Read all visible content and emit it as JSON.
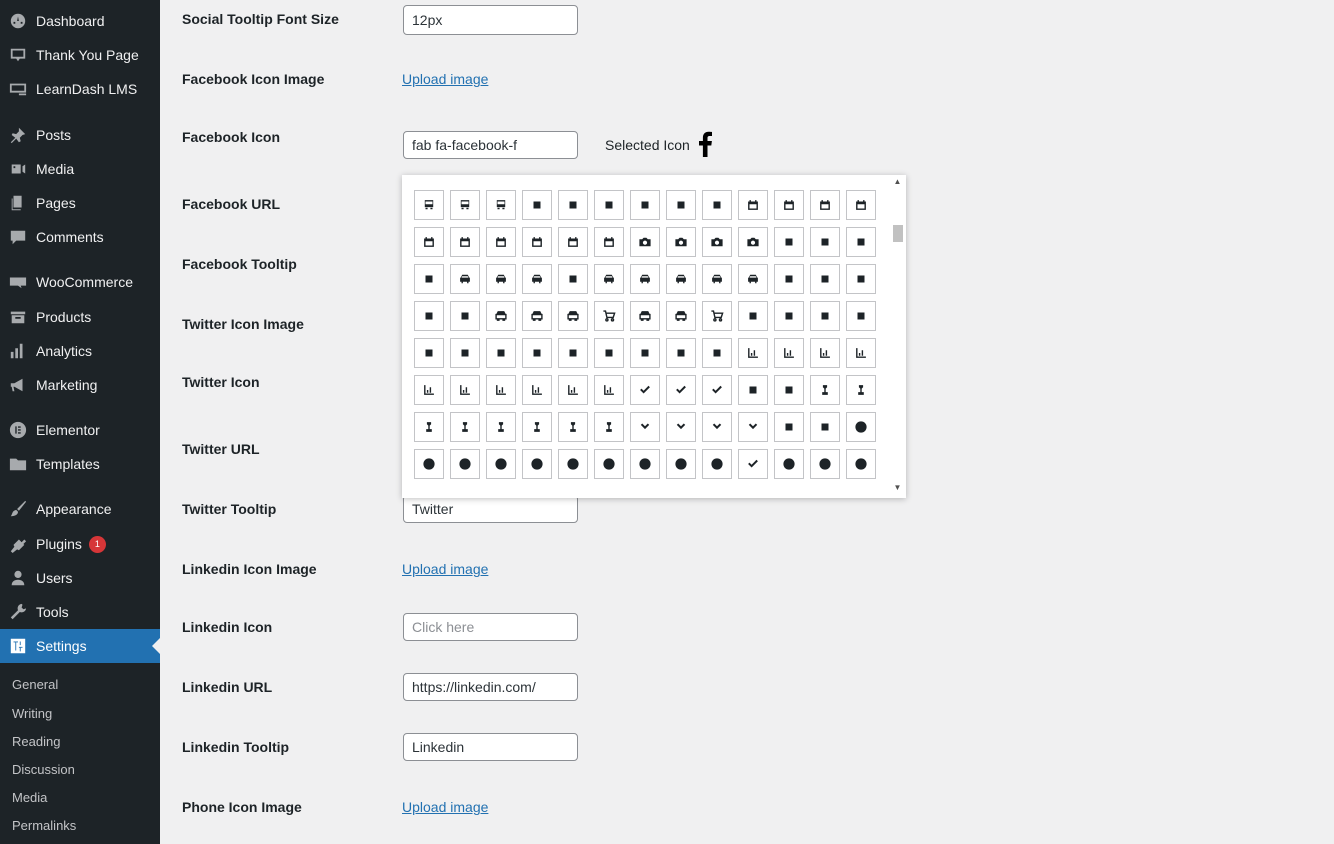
{
  "sidebar": {
    "items": [
      {
        "label": "Dashboard",
        "icon": "dashboard-icon"
      },
      {
        "label": "Thank You Page",
        "icon": "thank-you-icon"
      },
      {
        "label": "LearnDash LMS",
        "icon": "learndash-icon"
      },
      {
        "label": "Posts",
        "icon": "pin-icon"
      },
      {
        "label": "Media",
        "icon": "media-icon"
      },
      {
        "label": "Pages",
        "icon": "pages-icon"
      },
      {
        "label": "Comments",
        "icon": "comments-icon"
      },
      {
        "label": "WooCommerce",
        "icon": "woocommerce-icon"
      },
      {
        "label": "Products",
        "icon": "products-icon"
      },
      {
        "label": "Analytics",
        "icon": "analytics-icon"
      },
      {
        "label": "Marketing",
        "icon": "megaphone-icon"
      },
      {
        "label": "Elementor",
        "icon": "elementor-icon"
      },
      {
        "label": "Templates",
        "icon": "folder-icon"
      },
      {
        "label": "Appearance",
        "icon": "paintbrush-icon"
      },
      {
        "label": "Plugins",
        "icon": "plugin-icon",
        "badge": "1"
      },
      {
        "label": "Users",
        "icon": "user-icon"
      },
      {
        "label": "Tools",
        "icon": "wrench-icon"
      },
      {
        "label": "Settings",
        "icon": "settings-icon",
        "active": true
      }
    ],
    "submenu": [
      "General",
      "Writing",
      "Reading",
      "Discussion",
      "Media",
      "Permalinks"
    ]
  },
  "form": {
    "social_tooltip_font_size": {
      "label": "Social Tooltip Font Size",
      "value": "12px"
    },
    "facebook_icon_image": {
      "label": "Facebook Icon Image",
      "link": "Upload image"
    },
    "facebook_icon": {
      "label": "Facebook Icon",
      "value": "fab fa-facebook-f",
      "selected_label": "Selected Icon"
    },
    "facebook_url": {
      "label": "Facebook URL"
    },
    "facebook_tooltip": {
      "label": "Facebook Tooltip"
    },
    "twitter_icon_image": {
      "label": "Twitter Icon Image"
    },
    "twitter_icon": {
      "label": "Twitter Icon"
    },
    "twitter_url": {
      "label": "Twitter URL"
    },
    "twitter_tooltip": {
      "label": "Twitter Tooltip",
      "value": "Twitter"
    },
    "linkedin_icon_image": {
      "label": "Linkedin Icon Image",
      "link": "Upload image"
    },
    "linkedin_icon": {
      "label": "Linkedin Icon",
      "placeholder": "Click here"
    },
    "linkedin_url": {
      "label": "Linkedin URL",
      "value": "https://linkedin.com/"
    },
    "linkedin_tooltip": {
      "label": "Linkedin Tooltip",
      "value": "Linkedin"
    },
    "phone_icon_image": {
      "label": "Phone Icon Image",
      "link": "Upload image"
    }
  },
  "icon_picker": {
    "rows": [
      [
        "bus-icon",
        "bus-simple-icon",
        "business-time-icon",
        "suitcase-clock-icon",
        "c-icon",
        "cake-candles-icon",
        "birthday-cake-icon",
        "cake-icon",
        "calculator-icon",
        "calendar-icon",
        "calendar-check-icon",
        "calendar-day-icon",
        "calendar-days-icon"
      ],
      [
        "calendar-grid-icon",
        "calendar-minus-icon",
        "calendar-plus-icon",
        "calendar-week-icon",
        "calendar-xmark-icon",
        "calendar-times-icon",
        "camera-icon",
        "camera-retro-icon",
        "camera-alt-icon",
        "camera-rotate-icon",
        "campground-icon",
        "candy-cane-icon",
        "cannabis-icon"
      ],
      [
        "capsules-icon",
        "car-icon",
        "car-alt-icon",
        "car-battery-icon",
        "battery-car-icon",
        "car-crash-icon",
        "car-rear-icon",
        "car-side-icon",
        "car-sedan-icon",
        "caravan-icon",
        "caret-down-icon",
        "caret-left-icon",
        "caret-right-icon"
      ],
      [
        "caret-up-icon",
        "carrot-icon",
        "cart-arrow-down-icon",
        "cart-flatbed-icon",
        "cart-flatbed-suitcase-icon",
        "luggage-cart-icon",
        "cart-plus-icon",
        "cart-shopping-icon",
        "shopping-cart-icon",
        "cash-register-icon",
        "cat-icon",
        "cedi-sign-icon",
        "cent-sign-icon"
      ],
      [
        "certificate-icon",
        "chair-icon",
        "chalkboard-icon",
        "chalkboard-alt-icon",
        "chalkboard-teacher-icon",
        "chalkboard-user-icon",
        "champagne-glasses-icon",
        "glass-cheers-icon",
        "charging-station-icon",
        "chart-area-icon",
        "area-chart-icon",
        "chart-bar-icon",
        "bar-chart-icon"
      ],
      [
        "chart-column-icon",
        "chart-gantt-icon",
        "chart-line-icon",
        "line-chart-icon",
        "chart-pie-icon",
        "pie-chart-icon",
        "check-icon",
        "check-double-icon",
        "check-to-slot-icon",
        "vote-yea-icon",
        "cheese-icon",
        "chess-icon",
        "chess-bishop-icon"
      ],
      [
        "chess-board-icon",
        "chess-king-icon",
        "chess-knight-icon",
        "chess-pawn-icon",
        "chess-queen-icon",
        "chess-rook-icon",
        "chevron-down-icon",
        "chevron-left-icon",
        "chevron-right-icon",
        "chevron-up-icon",
        "child-icon",
        "church-icon",
        "circle-icon"
      ],
      [
        "circle-arrow-down-icon",
        "arrow-circle-down-icon",
        "circle-arrow-left-icon",
        "arrow-circle-left-icon",
        "circle-arrow-right-icon",
        "arrow-circle-right-icon",
        "circle-arrow-up-icon",
        "arrow-circle-up-icon",
        "circle-check-icon",
        "check-circle-icon",
        "circle-chevron-down-icon",
        "chevron-circle-down-icon",
        "circle-chevron-left-icon"
      ]
    ]
  }
}
